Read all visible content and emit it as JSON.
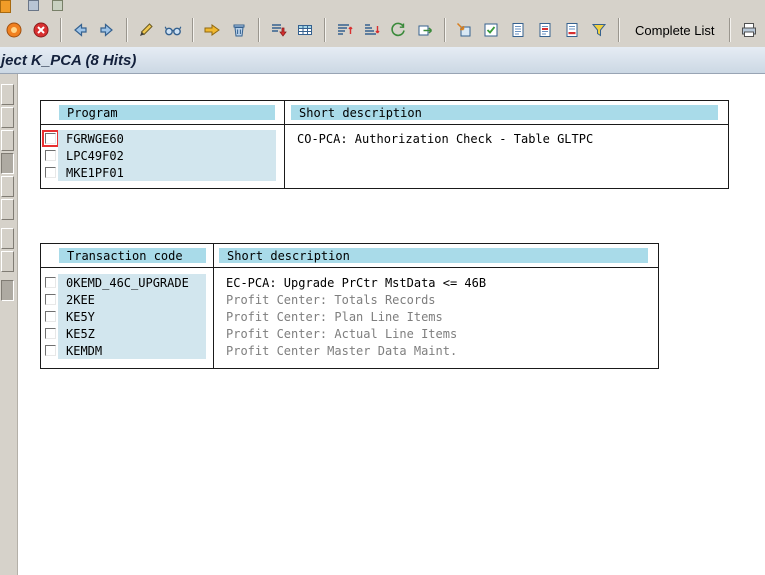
{
  "window": {
    "title": "ject K_PCA (8 Hits)"
  },
  "toolbar": {
    "complete_list_label": "Complete List",
    "icons": [
      "session-icon",
      "cancel-icon",
      "back-icon",
      "forward-icon",
      "edit-pencil-icon",
      "display-glasses-icon",
      "other-object-icon",
      "delete-trash-icon",
      "export-icon",
      "table-view-icon",
      "sort-ascending-icon",
      "sort-descending-icon",
      "refresh-icon",
      "open-object-icon",
      "import-icon",
      "checklist-icon",
      "detail-icon",
      "document-icon",
      "remove-line-icon",
      "filter-icon",
      "print-icon",
      "find-icon",
      "find-next-icon"
    ]
  },
  "programs_table": {
    "headers": [
      "Program",
      "Short description"
    ],
    "rows": [
      {
        "name": "FGRWGE60",
        "description": "CO-PCA: Authorization Check - Table GLTPC",
        "selected": false,
        "focused": true
      },
      {
        "name": "LPC49F02",
        "description": "",
        "selected": false,
        "focused": false
      },
      {
        "name": "MKE1PF01",
        "description": "",
        "selected": false,
        "focused": false
      }
    ]
  },
  "transactions_table": {
    "headers": [
      "Transaction code",
      "Short description"
    ],
    "rows": [
      {
        "code": "0KEMD_46C_UPGRADE",
        "description": "EC-PCA: Upgrade PrCtr MstData <= 46B",
        "selected": false,
        "dimmed": false
      },
      {
        "code": "2KEE",
        "description": "Profit Center: Totals Records",
        "selected": false,
        "dimmed": true
      },
      {
        "code": "KE5Y",
        "description": "Profit Center: Plan Line Items",
        "selected": false,
        "dimmed": true
      },
      {
        "code": "KE5Z",
        "description": "Profit Center: Actual Line Items",
        "selected": false,
        "dimmed": true
      },
      {
        "code": "KEMDM",
        "description": "Profit Center Master Data Maint.",
        "selected": false,
        "dimmed": true
      }
    ]
  },
  "colors": {
    "table_header_bg": "#a9dbe9",
    "key_cell_bg": "#d2e6ee",
    "focus_outline": "#e83030",
    "toolbar_bg": "#d6d2ca",
    "dimmed_text": "#7e7e7e"
  }
}
